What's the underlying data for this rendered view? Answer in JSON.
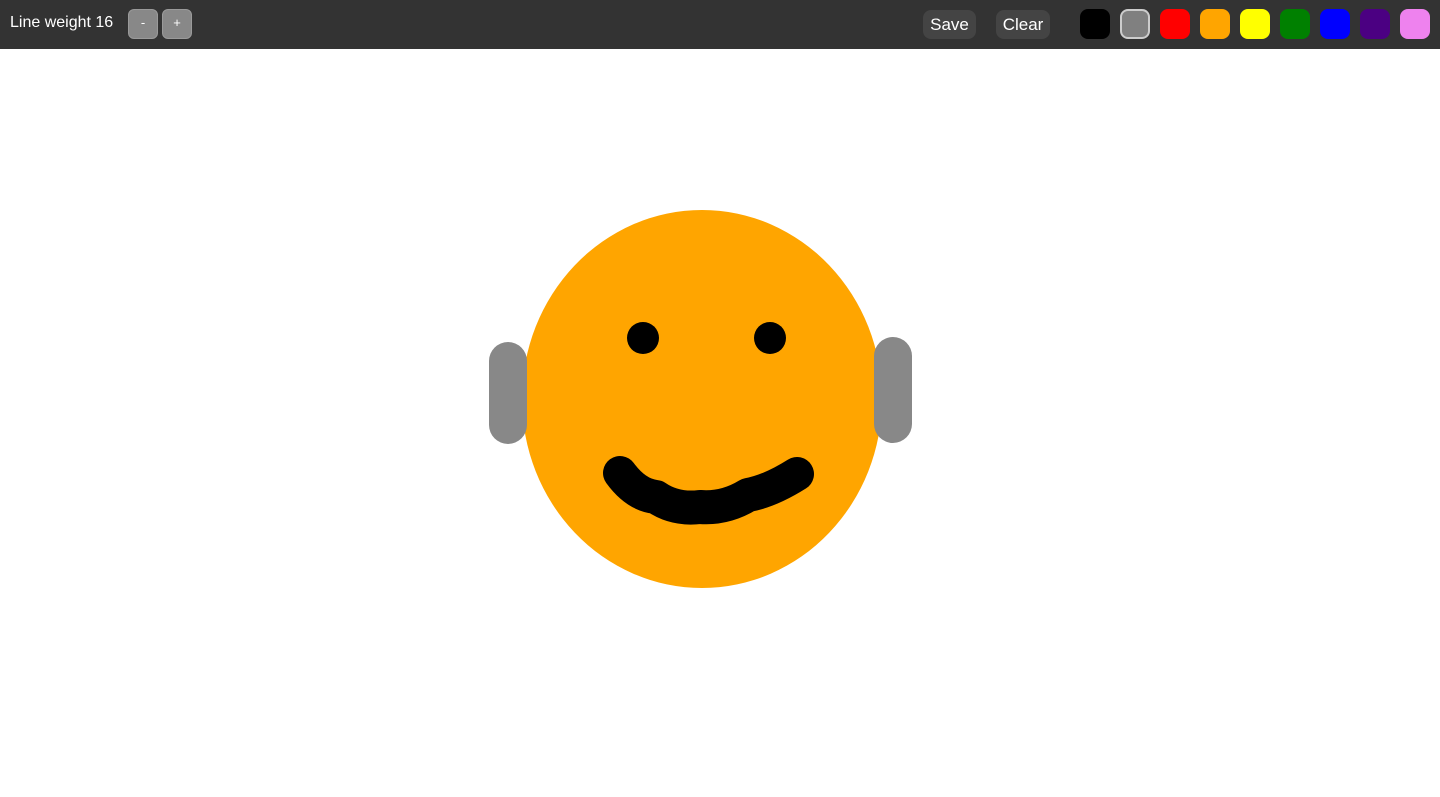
{
  "toolbar": {
    "weight_label": "Line weight 16",
    "minus_label": "-",
    "plus_label": "+",
    "save_label": "Save",
    "clear_label": "Clear"
  },
  "palette": {
    "selected": "gray",
    "swatches": [
      {
        "name": "black",
        "color": "#000000"
      },
      {
        "name": "gray",
        "color": "#808080"
      },
      {
        "name": "red",
        "color": "#ff0000"
      },
      {
        "name": "orange",
        "color": "#ffa500"
      },
      {
        "name": "yellow",
        "color": "#ffff00"
      },
      {
        "name": "green",
        "color": "#008000"
      },
      {
        "name": "blue",
        "color": "#0000ff"
      },
      {
        "name": "indigo",
        "color": "#4b0082"
      },
      {
        "name": "violet",
        "color": "#ee82ee"
      }
    ]
  },
  "drawing": {
    "colors": {
      "face": "#ffa500",
      "ears": "#888888",
      "features": "#000000"
    }
  }
}
